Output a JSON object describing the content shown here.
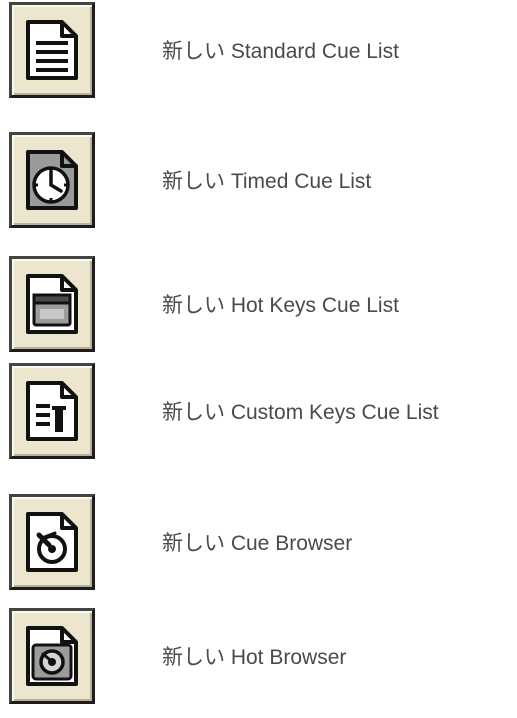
{
  "items": [
    {
      "icon": "standard-cue-list-icon",
      "label": "新しい Standard Cue List"
    },
    {
      "icon": "timed-cue-list-icon",
      "label": "新しい Timed Cue List"
    },
    {
      "icon": "hot-keys-cue-list-icon",
      "label": "新しい Hot Keys Cue List"
    },
    {
      "icon": "custom-keys-cue-list-icon",
      "label": "新しい Custom Keys Cue List"
    },
    {
      "icon": "cue-browser-icon",
      "label": "新しい Cue Browser"
    },
    {
      "icon": "hot-browser-icon",
      "label": "新しい Hot Browser"
    }
  ],
  "colors": {
    "button_face": "#ece6cf",
    "text": "#4a4a4a"
  }
}
